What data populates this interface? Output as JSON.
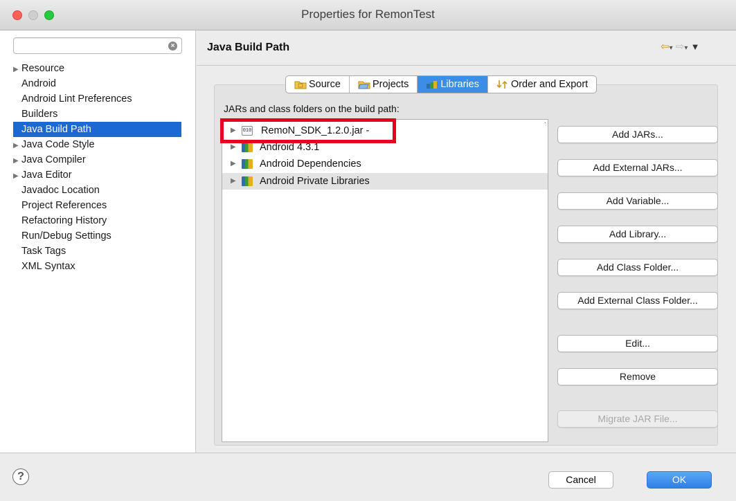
{
  "window": {
    "title": "Properties for RemonTest"
  },
  "sidebar": {
    "filter": {
      "value": "",
      "placeholder": ""
    },
    "items": [
      {
        "label": "Resource",
        "expandable": true,
        "selected": false
      },
      {
        "label": "Android",
        "expandable": false,
        "selected": false
      },
      {
        "label": "Android Lint Preferences",
        "expandable": false,
        "selected": false
      },
      {
        "label": "Builders",
        "expandable": false,
        "selected": false
      },
      {
        "label": "Java Build Path",
        "expandable": false,
        "selected": true
      },
      {
        "label": "Java Code Style",
        "expandable": true,
        "selected": false
      },
      {
        "label": "Java Compiler",
        "expandable": true,
        "selected": false
      },
      {
        "label": "Java Editor",
        "expandable": true,
        "selected": false
      },
      {
        "label": "Javadoc Location",
        "expandable": false,
        "selected": false
      },
      {
        "label": "Project References",
        "expandable": false,
        "selected": false
      },
      {
        "label": "Refactoring History",
        "expandable": false,
        "selected": false
      },
      {
        "label": "Run/Debug Settings",
        "expandable": false,
        "selected": false
      },
      {
        "label": "Task Tags",
        "expandable": false,
        "selected": false
      },
      {
        "label": "XML Syntax",
        "expandable": false,
        "selected": false
      }
    ]
  },
  "main": {
    "heading": "Java Build Path",
    "tabs": [
      {
        "label": "Source",
        "icon": "source-folder-icon",
        "active": false
      },
      {
        "label": "Projects",
        "icon": "projects-folder-icon",
        "active": false
      },
      {
        "label": "Libraries",
        "icon": "libraries-icon",
        "active": true
      },
      {
        "label": "Order and Export",
        "icon": "order-export-icon",
        "active": false
      }
    ],
    "list_label": "JARs and class folders on the build path:",
    "entries": [
      {
        "label": "RemoN_SDK_1.2.0.jar -",
        "icon": "jar-icon",
        "highlighted": false
      },
      {
        "label": "Android 4.3.1",
        "icon": "library-icon",
        "highlighted": false
      },
      {
        "label": "Android Dependencies",
        "icon": "library-icon",
        "highlighted": false
      },
      {
        "label": "Android Private Libraries",
        "icon": "library-icon",
        "highlighted": true
      }
    ],
    "buttons": {
      "add_jars": "Add JARs...",
      "add_external_jars": "Add External JARs...",
      "add_variable": "Add Variable...",
      "add_library": "Add Library...",
      "add_class_folder": "Add Class Folder...",
      "add_external_class_folder": "Add External Class Folder...",
      "edit": "Edit...",
      "remove": "Remove",
      "migrate_jar": "Migrate JAR File..."
    }
  },
  "footer": {
    "help": "?",
    "cancel": "Cancel",
    "ok": "OK"
  },
  "colors": {
    "selection": "#1c69d4",
    "active_tab": "#3b8de6",
    "annotation_box": "#e8001c",
    "ok_button": "#2f7fe6"
  }
}
